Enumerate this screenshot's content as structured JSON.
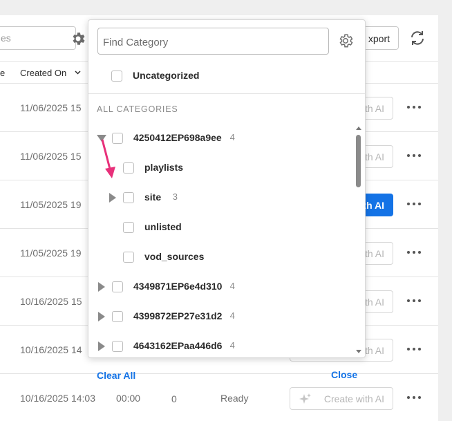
{
  "toolbar": {
    "search_fragment": "es",
    "export_label": "xport"
  },
  "table": {
    "partial_header": "e",
    "created_on_header": "Created On",
    "rows": [
      {
        "date": "11/06/2025 15",
        "duration": "",
        "zero": "",
        "status": "",
        "ai_label": "th AI",
        "ai_style": "disabled"
      },
      {
        "date": "11/06/2025 15",
        "duration": "",
        "zero": "",
        "status": "",
        "ai_label": "th AI",
        "ai_style": "disabled"
      },
      {
        "date": "11/05/2025 19",
        "duration": "",
        "zero": "",
        "status": "",
        "ai_label": "th AI",
        "ai_style": "primary"
      },
      {
        "date": "11/05/2025 19",
        "duration": "",
        "zero": "",
        "status": "",
        "ai_label": "th AI",
        "ai_style": "disabled"
      },
      {
        "date": "10/16/2025 15",
        "duration": "",
        "zero": "",
        "status": "",
        "ai_label": "th AI",
        "ai_style": "disabled"
      },
      {
        "date": "10/16/2025 14",
        "duration": "",
        "zero": "",
        "status": "",
        "ai_label": "th AI",
        "ai_style": "disabled"
      },
      {
        "date": "10/16/2025 14:03",
        "duration": "00:00",
        "zero": "0",
        "status": "Ready",
        "ai_label": "Create with AI",
        "ai_style": "disabled"
      }
    ]
  },
  "category_picker": {
    "find_placeholder": "Find Category",
    "uncategorized_label": "Uncategorized",
    "section_label": "ALL CATEGORIES",
    "items": [
      {
        "label": "4250412EP698a9ee",
        "count": "4",
        "level": 0,
        "expander": "expanded"
      },
      {
        "label": "playlists",
        "count": "",
        "level": 1,
        "expander": "none"
      },
      {
        "label": "site",
        "count": "3",
        "level": 1,
        "expander": "collapsed"
      },
      {
        "label": "unlisted",
        "count": "",
        "level": 1,
        "expander": "none"
      },
      {
        "label": "vod_sources",
        "count": "",
        "level": 1,
        "expander": "none"
      },
      {
        "label": "4349871EP6e4d310",
        "count": "4",
        "level": 0,
        "expander": "collapsed"
      },
      {
        "label": "4399872EP27e31d2",
        "count": "4",
        "level": 0,
        "expander": "collapsed"
      },
      {
        "label": "4643162EPaa446d6",
        "count": "4",
        "level": 0,
        "expander": "collapsed"
      }
    ],
    "clear_all_label": "Clear All",
    "close_label": "Close"
  },
  "colors": {
    "accent": "#1473e6",
    "annotation_arrow": "#e8307a"
  },
  "icons": [
    "settings-gear-icon",
    "refresh-icon",
    "chevron-down-icon",
    "sparkle-icon",
    "more-dots-icon",
    "expand-triangle-icon",
    "collapse-triangle-icon"
  ]
}
